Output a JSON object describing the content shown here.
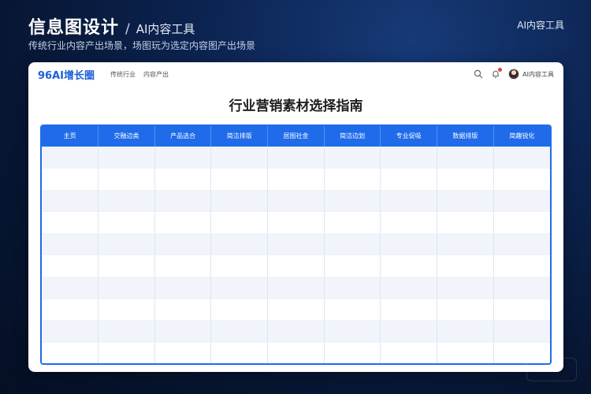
{
  "header": {
    "title": "信息图设计",
    "separator": "/",
    "category": "AI内容工具",
    "subtitle": "传统行业内容产出场景，场图玩为选定内容图产出场景",
    "top_right_label": "AI内容工具"
  },
  "app": {
    "brand": "96AI增长圈",
    "nav_links": [
      "传统行业",
      "内容产出"
    ],
    "icons": [
      "search-icon",
      "bell-icon",
      "avatar"
    ],
    "user_name": "AI内容工具",
    "notification_color": "#e83b3b"
  },
  "page": {
    "heading": "行业营销素材选择指南"
  },
  "table": {
    "columns": [
      "主页",
      "交融边类",
      "产品选合",
      "简洁排版",
      "居图社金",
      "简洁边划",
      "专业促吸",
      "数据排版",
      "简趣锐化"
    ],
    "row_count": 10,
    "header_color": "#1f6bea"
  }
}
